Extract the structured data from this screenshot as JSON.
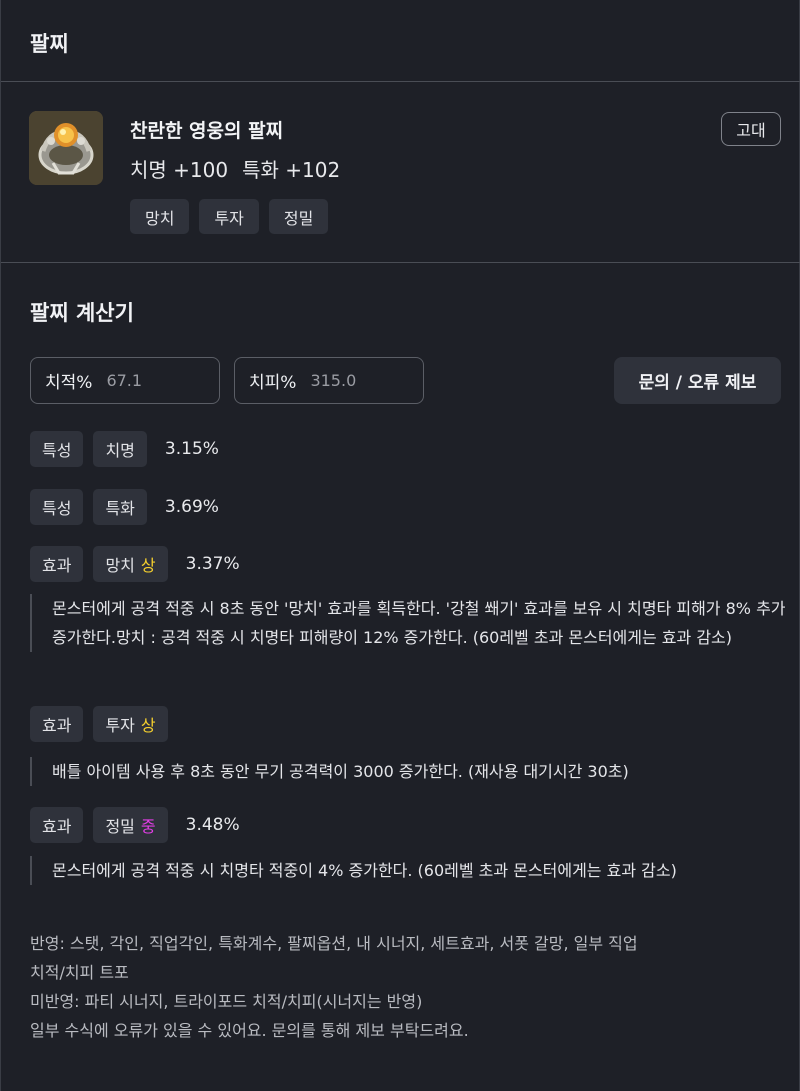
{
  "header": {
    "title": "팔찌"
  },
  "item": {
    "name": "찬란한 영웅의 팔찌",
    "stats": [
      "치명 +100",
      "특화 +102"
    ],
    "grade": "고대",
    "tags": [
      "망치",
      "투자",
      "정밀"
    ],
    "icon": "bracelet-icon"
  },
  "calculator": {
    "title": "팔찌 계산기",
    "crit_rate": {
      "label": "치적%",
      "value": "67.1"
    },
    "crit_damage": {
      "label": "치피%",
      "value": "315.0"
    },
    "report_button": "문의 / 오류 제보"
  },
  "rows": [
    {
      "type": "특성",
      "name": "치명",
      "grade": "",
      "value": "3.15%"
    },
    {
      "type": "특성",
      "name": "특화",
      "grade": "",
      "value": "3.69%"
    },
    {
      "type": "효과",
      "name": "망치",
      "grade": "상",
      "value": "3.37%",
      "desc": "몬스터에게 공격 적중 시 8초 동안 '망치' 효과를 획득한다. '강철 쐐기' 효과를 보유 시 치명타 피해가 8% 추가 증가한다.망치 : 공격 적중 시 치명타 피해량이 12% 증가한다. (60레벨 초과 몬스터에게는 효과 감소)"
    },
    {
      "type": "효과",
      "name": "투자",
      "grade": "상",
      "value": "",
      "desc": "배틀 아이템 사용 후 8초 동안 무기 공격력이 3000 증가한다. (재사용 대기시간 30초)"
    },
    {
      "type": "효과",
      "name": "정밀",
      "grade": "중",
      "value": "3.48%",
      "desc": "몬스터에게 공격 적중 시 치명타 적중이 4% 증가한다. (60레벨 초과 몬스터에게는 효과 감소)"
    }
  ],
  "colors": {
    "grade_high": "#f4cf2e",
    "grade_mid": "#e23ee6",
    "background": "#1e2027",
    "chip": "#2f323b"
  },
  "footer": {
    "lines": [
      "반영: 스탯, 각인, 직업각인, 특화계수, 팔찌옵션, 내 시너지, 세트효과, 서폿 갈망, 일부 직업",
      "치적/치피 트포",
      "미반영: 파티 시너지, 트라이포드 치적/치피(시너지는 반영)",
      "일부 수식에 오류가 있을 수 있어요. 문의를 통해 제보 부탁드려요."
    ]
  }
}
